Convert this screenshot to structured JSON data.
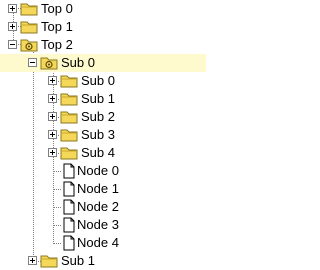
{
  "tree": {
    "top": [
      {
        "label": "Top 0",
        "expander": "plus",
        "icon": "folder-closed-icon"
      },
      {
        "label": "Top 1",
        "expander": "plus",
        "icon": "folder-closed-icon"
      },
      {
        "label": "Top 2",
        "expander": "minus",
        "icon": "folder-open-icon"
      }
    ],
    "sub_selected": {
      "label": "Sub 0",
      "expander": "minus",
      "icon": "folder-open-icon",
      "selected": true
    },
    "subs": [
      {
        "label": "Sub 0",
        "expander": "plus",
        "icon": "folder-closed-icon"
      },
      {
        "label": "Sub 1",
        "expander": "plus",
        "icon": "folder-closed-icon"
      },
      {
        "label": "Sub 2",
        "expander": "plus",
        "icon": "folder-closed-icon"
      },
      {
        "label": "Sub 3",
        "expander": "plus",
        "icon": "folder-closed-icon"
      },
      {
        "label": "Sub 4",
        "expander": "plus",
        "icon": "folder-closed-icon"
      }
    ],
    "nodes": [
      {
        "label": "Node 0",
        "icon": "document-icon"
      },
      {
        "label": "Node 1",
        "icon": "document-icon"
      },
      {
        "label": "Node 2",
        "icon": "document-icon"
      },
      {
        "label": "Node 3",
        "icon": "document-icon"
      },
      {
        "label": "Node 4",
        "icon": "document-icon"
      }
    ],
    "bottom_sub": {
      "label": "Sub 1",
      "expander": "plus",
      "icon": "folder-closed-icon"
    }
  },
  "colors": {
    "selection": "#fffacd",
    "folder": "#f5d85a",
    "folder_outline": "#8a7a1e",
    "tree_lines": "#808080"
  }
}
